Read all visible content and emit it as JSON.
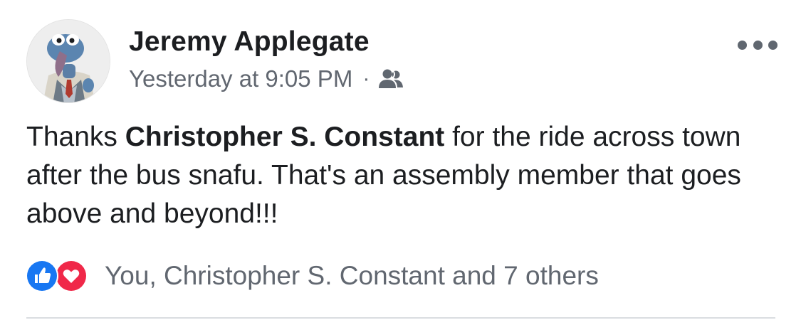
{
  "post": {
    "author": "Jeremy Applegate",
    "timestamp": "Yesterday at 9:05 PM",
    "separator": "·",
    "audience_icon": "friends-icon",
    "more_icon": "more-options-icon",
    "text": {
      "before_mention": "Thanks ",
      "mention": "Christopher S. Constant",
      "after_mention": " for the ride across town after the bus snafu. That's an assembly member that goes above and beyond!!!"
    },
    "reactions": {
      "icons": [
        "like-reaction-icon",
        "love-reaction-icon"
      ],
      "summary": "You, Christopher S. Constant and 7 others"
    }
  },
  "colors": {
    "text_primary": "#1c1e21",
    "text_secondary": "#616770",
    "like_blue": "#1877f2",
    "love_red": "#f02849",
    "divider": "#dadde1"
  }
}
